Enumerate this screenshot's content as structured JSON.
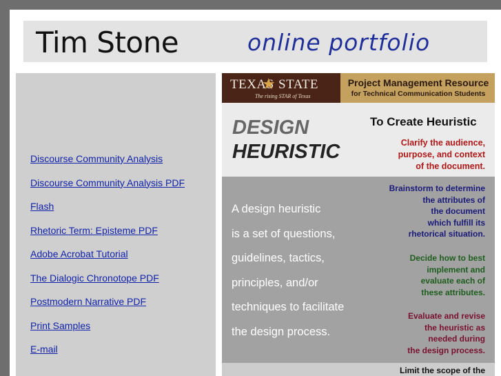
{
  "header": {
    "name": "Tim Stone",
    "subtitle": "online portfolio"
  },
  "nav": [
    {
      "label": "Discourse Community Analysis"
    },
    {
      "label": "Discourse Community Analysis PDF"
    },
    {
      "label": "Flash"
    },
    {
      "label": "Rhetoric Term: Episteme PDF"
    },
    {
      "label": "Adobe Acrobat Tutorial"
    },
    {
      "label": "The Dialogic Chronotope PDF"
    },
    {
      "label": "Postmodern Narrative PDF"
    },
    {
      "label": "Print Samples"
    },
    {
      "label": "E-mail"
    }
  ],
  "poster": {
    "logo_word_left": "TEXAS",
    "logo_word_right": "STATE",
    "logo_tagline": "The rising STAR of Texas",
    "banner_title": "Project Management Resource",
    "banner_subtitle": "for Technical Communication Students",
    "heading_1": "DESIGN",
    "heading_2": "HEURISTIC",
    "to_create": "To Create Heuristic",
    "clarify": "Clarify the audience,\npurpose, and context\nof the document.",
    "definition": "A design heuristic\nis a set of questions,\nguidelines, tactics,\nprinciples, and/or\ntechniques to facilitate\nthe design process.",
    "step_brainstorm": "Brainstorm to determine\nthe attributes of\nthe document\nwhich fulfill its\nrhetorical situation.",
    "step_decide": "Decide how to best\nimplement and\nevaluate each of\nthese attributes.",
    "step_evaluate": "Evaluate and revise\nthe heuristic as\nneeded during\nthe design process.",
    "step_limit": "Limit the scope of the"
  },
  "colors": {
    "page_bg": "#6e6e6e",
    "header_bg": "#e3e3e3",
    "sidebar_bg": "#cfcfcf",
    "link": "#1122aa",
    "subtitle": "#1f2f9a",
    "logo_bg": "#4a2417",
    "banner_gold": "#c4a15f"
  }
}
